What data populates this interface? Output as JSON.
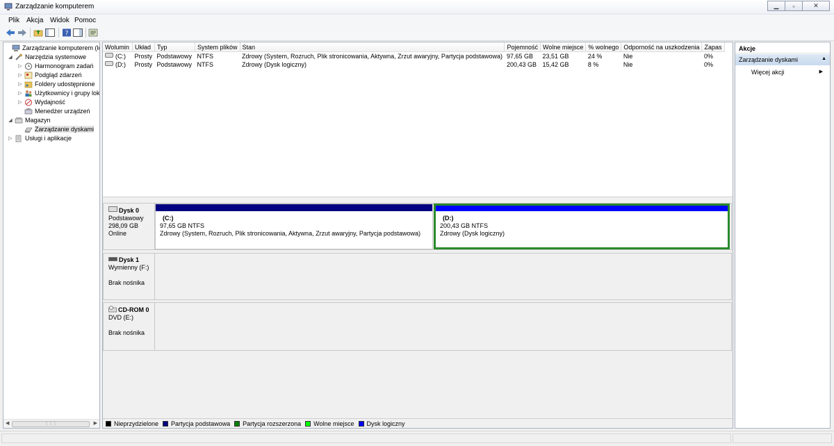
{
  "window": {
    "title": "Zarządzanie komputerem"
  },
  "menu": [
    "Plik",
    "Akcja",
    "Widok",
    "Pomoc"
  ],
  "toolbar": {
    "icons": [
      "back-icon",
      "forward-icon",
      "up-folder-icon",
      "show-hide-tree-icon",
      "help-icon",
      "show-hide-actions-icon",
      "properties-icon"
    ]
  },
  "tree": {
    "items": [
      {
        "label": "Zarządzanie komputerem (loka",
        "exp": "",
        "icon": "computer-management-icon"
      },
      {
        "label": "Narzędzia systemowe",
        "exp": "◢",
        "icon": "tools-icon"
      },
      {
        "label": "Harmonogram zadań",
        "exp": "▷",
        "icon": "clock-icon"
      },
      {
        "label": "Podgląd zdarzeń",
        "exp": "▷",
        "icon": "event-viewer-icon"
      },
      {
        "label": "Foldery udostępnione",
        "exp": "▷",
        "icon": "shared-folder-icon"
      },
      {
        "label": "Użytkownicy i grupy lok",
        "exp": "▷",
        "icon": "users-icon"
      },
      {
        "label": "Wydajność",
        "exp": "▷",
        "icon": "performance-icon"
      },
      {
        "label": "Menedżer urządzeń",
        "exp": "",
        "icon": "device-manager-icon"
      },
      {
        "label": "Magazyn",
        "exp": "◢",
        "icon": "storage-icon"
      },
      {
        "label": "Zarządzanie dyskami",
        "exp": "",
        "icon": "disk-management-icon"
      },
      {
        "label": "Usługi i aplikacje",
        "exp": "▷",
        "icon": "services-icon"
      }
    ]
  },
  "volumes": {
    "headers": [
      "Wolumin",
      "Układ",
      "Typ",
      "System plików",
      "Stan",
      "Pojemność",
      "Wolne miejsce",
      "% wolnego",
      "Odporność na uszkodzenia",
      "Zapas"
    ],
    "rows": [
      [
        "(C:)",
        "Prosty",
        "Podstawowy",
        "NTFS",
        "Zdrowy (System, Rozruch, Plik stronicowania, Aktywna, Zrzut awaryjny, Partycja podstawowa)",
        "97,65 GB",
        "23,51 GB",
        "24 %",
        "Nie",
        "0%"
      ],
      [
        "(D:)",
        "Prosty",
        "Podstawowy",
        "NTFS",
        "Zdrowy (Dysk logiczny)",
        "200,43 GB",
        "15,42 GB",
        "8 %",
        "Nie",
        "0%"
      ]
    ]
  },
  "disks": [
    {
      "name": "Dysk 0",
      "line1": "Podstawowy",
      "line2": "298,09 GB",
      "line3": "Online",
      "partitions": [
        {
          "name": "(C:)",
          "size": "97,65 GB NTFS",
          "status": "Zdrowy (System, Rozruch, Plik stronicowania, Aktywna, Zrzut awaryjny, Partycja podstawowa)",
          "color": "#000080"
        },
        {
          "name": "(D:)",
          "size": "200,43 GB NTFS",
          "status": "Zdrowy (Dysk logiczny)",
          "color": "#0000ff"
        }
      ]
    },
    {
      "name": "Dysk 1",
      "line1": "Wymienny (F:)",
      "line2": "",
      "line3": "Brak nośnika"
    },
    {
      "name": "CD-ROM 0",
      "line1": "DVD (E:)",
      "line2": "",
      "line3": "Brak nośnika"
    }
  ],
  "legend": [
    {
      "label": "Nieprzydzielone",
      "color": "#000000"
    },
    {
      "label": "Partycja podstawowa",
      "color": "#000080"
    },
    {
      "label": "Partycja rozszerzona",
      "color": "#008000"
    },
    {
      "label": "Wolne miejsce",
      "color": "#00ff00"
    },
    {
      "label": "Dysk logiczny",
      "color": "#0000ff"
    }
  ],
  "actions": {
    "title": "Akcje",
    "section": "Zarządzanie dyskami",
    "more": "Więcej akcji"
  }
}
